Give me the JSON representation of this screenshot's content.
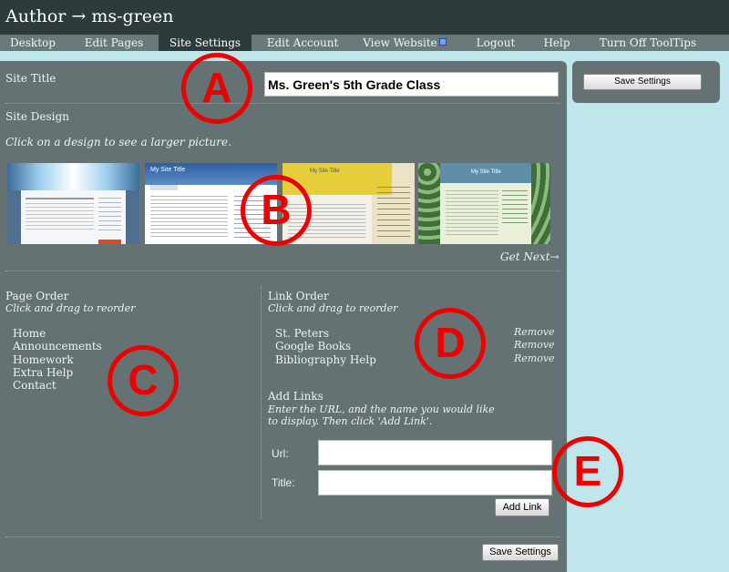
{
  "app": {
    "title": "Author → ms-green"
  },
  "nav": [
    {
      "label": "Desktop"
    },
    {
      "label": "Edit Pages"
    },
    {
      "label": "Site Settings"
    },
    {
      "label": "Edit Account"
    },
    {
      "label": "View Website"
    },
    {
      "label": "Logout"
    },
    {
      "label": "Help"
    },
    {
      "label": "Turn Off ToolTips"
    }
  ],
  "site_title": {
    "label": "Site Title",
    "value": "Ms. Green's 5th Grade Class"
  },
  "site_design": {
    "label": "Site Design",
    "hint": "Click on a design to see a larger picture.",
    "thumb_title": "My Site Title",
    "get_next": "Get Next→"
  },
  "page_order": {
    "label": "Page Order",
    "hint": "Click and drag to reorder",
    "items": [
      "Home",
      "Announcements",
      "Homework",
      "Extra Help",
      "Contact"
    ]
  },
  "link_order": {
    "label": "Link Order",
    "hint": "Click and drag to reorder",
    "items": [
      "St. Peters",
      "Google Books",
      "Bibliography Help"
    ],
    "remove_label": "Remove"
  },
  "add_links": {
    "label": "Add Links",
    "hint": "Enter the URL, and the name you would like to display. Then click 'Add Link'.",
    "url_label": "Url:",
    "title_label": "Title:",
    "url_value": "",
    "title_value": "",
    "button": "Add Link"
  },
  "save_button": "Save Settings",
  "callouts": [
    "A",
    "B",
    "C",
    "D",
    "E"
  ],
  "colors": {
    "accent": "#e00000",
    "panel": "#647273",
    "topbar": "#2e3b3c",
    "background": "#bfe6ea"
  }
}
